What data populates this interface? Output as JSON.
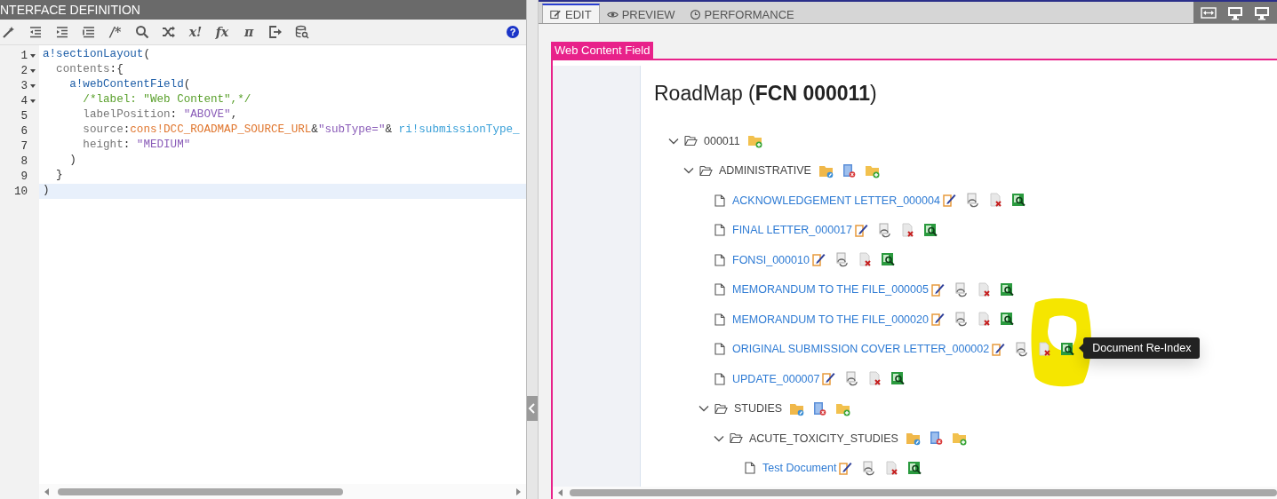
{
  "left_panel": {
    "title": "NTERFACE DEFINITION",
    "toolbar": [
      {
        "kind": "wand"
      },
      {
        "kind": "outdent"
      },
      {
        "kind": "indent"
      },
      {
        "kind": "list"
      },
      {
        "kind": "glyph",
        "text": "/*"
      },
      {
        "kind": "search"
      },
      {
        "kind": "shuffle"
      },
      {
        "kind": "glyph",
        "text": "x!"
      },
      {
        "kind": "glyph",
        "text": "fx"
      },
      {
        "kind": "glyph",
        "text": "π"
      },
      {
        "kind": "export"
      },
      {
        "kind": "database"
      }
    ],
    "help": "?",
    "code_lines": [
      {
        "number": "1",
        "foldable": true,
        "current": false,
        "tokens": [
          {
            "kind": "func",
            "text": "a!sectionLayout"
          },
          {
            "kind": "punct",
            "text": "("
          }
        ]
      },
      {
        "number": "2",
        "foldable": true,
        "current": false,
        "tokens": [
          {
            "kind": "key",
            "text": "  contents"
          },
          {
            "kind": "punct",
            "text": ":{"
          }
        ]
      },
      {
        "number": "3",
        "foldable": true,
        "current": false,
        "tokens": [
          {
            "kind": "func",
            "text": "    a!webContentField"
          },
          {
            "kind": "punct",
            "text": "("
          }
        ]
      },
      {
        "number": "4",
        "foldable": true,
        "current": false,
        "tokens": [
          {
            "kind": "comment",
            "text": "      /*label: \"Web Content\",*/"
          }
        ]
      },
      {
        "number": "5",
        "foldable": false,
        "current": false,
        "tokens": [
          {
            "kind": "key",
            "text": "      labelPosition"
          },
          {
            "kind": "punct",
            "text": ": "
          },
          {
            "kind": "string",
            "text": "\"ABOVE\""
          },
          {
            "kind": "punct",
            "text": ","
          }
        ]
      },
      {
        "number": "6",
        "foldable": false,
        "current": false,
        "tokens": [
          {
            "kind": "key",
            "text": "      source"
          },
          {
            "kind": "punct",
            "text": ":"
          },
          {
            "kind": "const",
            "text": "cons!DCC_ROADMAP_SOURCE_URL"
          },
          {
            "kind": "punct",
            "text": "&"
          },
          {
            "kind": "string",
            "text": "\"subType=\""
          },
          {
            "kind": "punct",
            "text": "& "
          },
          {
            "kind": "var",
            "text": "ri!submissionType_"
          }
        ]
      },
      {
        "number": "7",
        "foldable": false,
        "current": false,
        "tokens": [
          {
            "kind": "key",
            "text": "      height"
          },
          {
            "kind": "punct",
            "text": ": "
          },
          {
            "kind": "string",
            "text": "\"MEDIUM\""
          }
        ]
      },
      {
        "number": "8",
        "foldable": false,
        "current": false,
        "tokens": [
          {
            "kind": "punct",
            "text": "    )"
          }
        ]
      },
      {
        "number": "9",
        "foldable": false,
        "current": false,
        "tokens": [
          {
            "kind": "punct",
            "text": "  }"
          }
        ]
      },
      {
        "number": "10",
        "foldable": false,
        "current": true,
        "tokens": [
          {
            "kind": "punct",
            "text": ")"
          }
        ]
      }
    ]
  },
  "right_panel": {
    "tabs": [
      {
        "label": "EDIT",
        "kind": "edit",
        "selected": true
      },
      {
        "label": "PREVIEW",
        "kind": "preview",
        "selected": false
      },
      {
        "label": "PERFORMANCE",
        "kind": "performance",
        "selected": false
      }
    ],
    "view_buttons": [
      {
        "kind": "fit"
      },
      {
        "kind": "desktop"
      },
      {
        "kind": "desktop"
      }
    ],
    "field_label": "Web Content Field",
    "title": "RoadMap (**FCN 000011**)",
    "tree": [
      {
        "kind": "folder",
        "label": "000011",
        "expanded": true,
        "actions": [
          {
            "kind": "add-folder"
          }
        ],
        "children": [
          {
            "kind": "folder",
            "label": "ADMINISTRATIVE",
            "expanded": true,
            "actions": [
              {
                "kind": "edit-folder"
              },
              {
                "kind": "delete-folder"
              },
              {
                "kind": "add-folder"
              }
            ],
            "children": [
              {
                "kind": "document",
                "label": "ACKNOWLEDGEMENT LETTER_000004",
                "actions": [
                  {
                    "kind": "edit-doc"
                  },
                  {
                    "kind": "refresh-doc"
                  },
                  {
                    "kind": "delete-doc"
                  },
                  {
                    "kind": "reindex"
                  }
                ]
              },
              {
                "kind": "document",
                "label": "FINAL LETTER_000017",
                "actions": [
                  {
                    "kind": "edit-doc"
                  },
                  {
                    "kind": "refresh-doc"
                  },
                  {
                    "kind": "delete-doc"
                  },
                  {
                    "kind": "reindex"
                  }
                ]
              },
              {
                "kind": "document",
                "label": "FONSI_000010",
                "actions": [
                  {
                    "kind": "edit-doc"
                  },
                  {
                    "kind": "refresh-doc"
                  },
                  {
                    "kind": "delete-doc"
                  },
                  {
                    "kind": "reindex"
                  }
                ]
              },
              {
                "kind": "document",
                "label": "MEMORANDUM TO THE FILE_000005",
                "actions": [
                  {
                    "kind": "edit-doc"
                  },
                  {
                    "kind": "refresh-doc"
                  },
                  {
                    "kind": "delete-doc"
                  },
                  {
                    "kind": "reindex"
                  }
                ]
              },
              {
                "kind": "document",
                "label": "MEMORANDUM TO THE FILE_000020",
                "actions": [
                  {
                    "kind": "edit-doc"
                  },
                  {
                    "kind": "refresh-doc"
                  },
                  {
                    "kind": "delete-doc"
                  },
                  {
                    "kind": "reindex"
                  }
                ]
              },
              {
                "kind": "document",
                "label": "ORIGINAL SUBMISSION COVER LETTER_000002",
                "actions": [
                  {
                    "kind": "edit-doc"
                  },
                  {
                    "kind": "refresh-doc"
                  },
                  {
                    "kind": "delete-doc"
                  },
                  {
                    "kind": "reindex",
                    "highlighted": true,
                    "tooltip": "Document Re-Index"
                  }
                ]
              },
              {
                "kind": "document",
                "label": "UPDATE_000007",
                "actions": [
                  {
                    "kind": "edit-doc"
                  },
                  {
                    "kind": "refresh-doc"
                  },
                  {
                    "kind": "delete-doc"
                  },
                  {
                    "kind": "reindex"
                  }
                ]
              },
              {
                "kind": "folder",
                "label": "STUDIES",
                "expanded": true,
                "actions": [
                  {
                    "kind": "edit-folder"
                  },
                  {
                    "kind": "delete-folder"
                  },
                  {
                    "kind": "add-folder"
                  }
                ],
                "children": [
                  {
                    "kind": "folder",
                    "label": "ACUTE_TOXICITY_STUDIES",
                    "expanded": true,
                    "actions": [
                      {
                        "kind": "edit-folder"
                      },
                      {
                        "kind": "delete-folder"
                      },
                      {
                        "kind": "add-folder"
                      }
                    ],
                    "children": [
                      {
                        "kind": "document",
                        "label": "Test Document",
                        "actions": [
                          {
                            "kind": "edit-doc"
                          },
                          {
                            "kind": "refresh-doc"
                          },
                          {
                            "kind": "delete-doc"
                          },
                          {
                            "kind": "reindex"
                          }
                        ]
                      }
                    ]
                  }
                ]
              }
            ]
          }
        ]
      }
    ]
  }
}
